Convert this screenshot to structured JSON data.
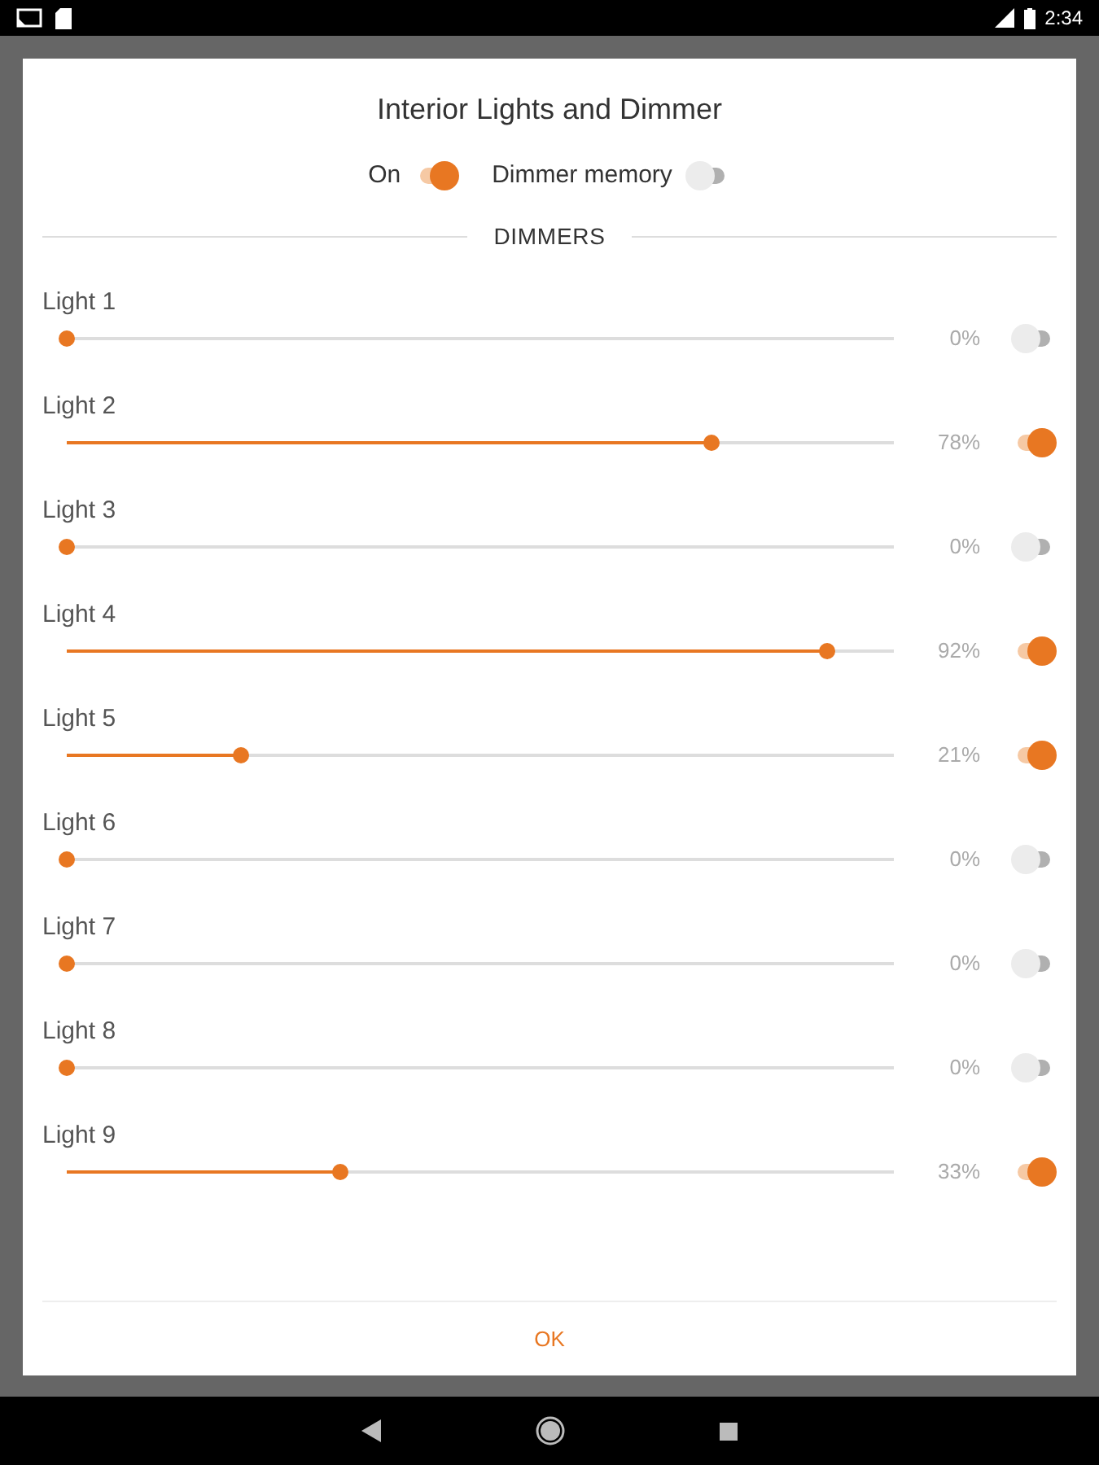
{
  "status_bar": {
    "time": "2:34"
  },
  "dialog": {
    "title": "Interior Lights and Dimmer",
    "switches": [
      {
        "label": "On",
        "on": true
      },
      {
        "label": "Dimmer memory",
        "on": false
      }
    ],
    "section": "DIMMERS",
    "lights": [
      {
        "name": "Light 1",
        "level": 0,
        "reading": "0%",
        "on": false
      },
      {
        "name": "Light 2",
        "level": 0.78,
        "reading": "78%",
        "on": true
      },
      {
        "name": "Light 3",
        "level": 0,
        "reading": "0%",
        "on": false
      },
      {
        "name": "Light 4",
        "level": 0.92,
        "reading": "92%",
        "on": true
      },
      {
        "name": "Light 5",
        "level": 0.21,
        "reading": "21%",
        "on": true
      },
      {
        "name": "Light 6",
        "level": 0,
        "reading": "0%",
        "on": false
      },
      {
        "name": "Light 7",
        "level": 0,
        "reading": "0%",
        "on": false
      },
      {
        "name": "Light 8",
        "level": 0,
        "reading": "0%",
        "on": false
      },
      {
        "name": "Light 9",
        "level": 0.33,
        "reading": "33%",
        "on": true
      }
    ],
    "button": "OK"
  }
}
